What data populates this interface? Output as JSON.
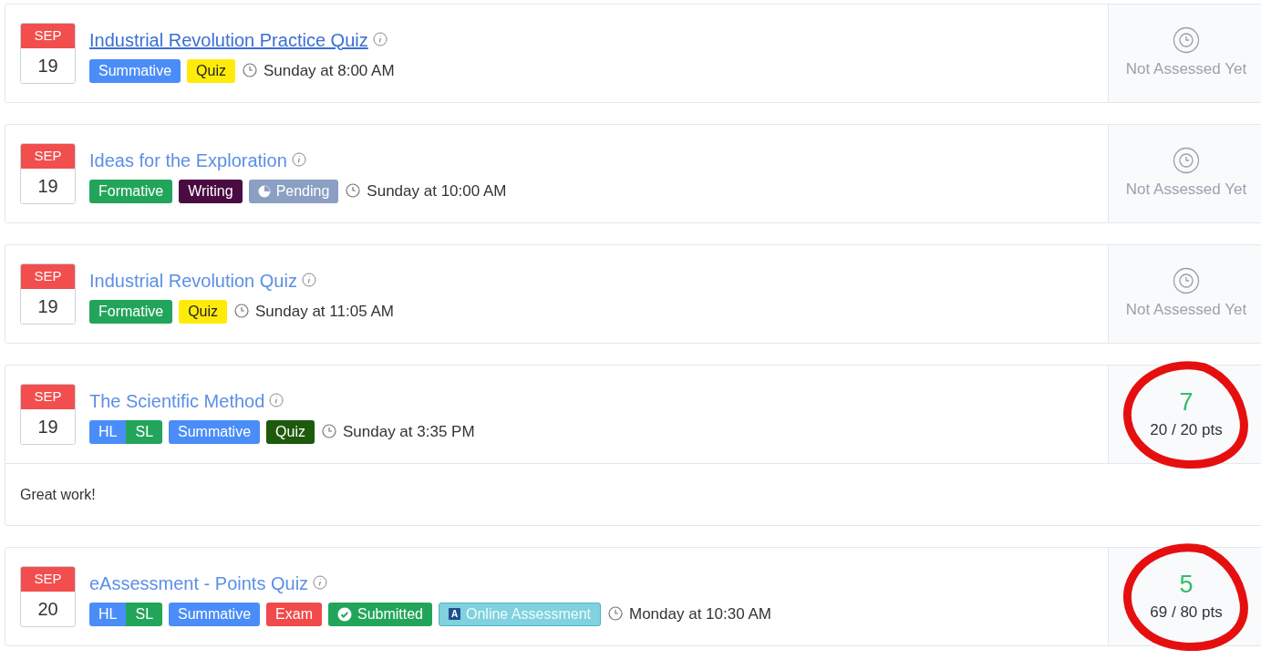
{
  "assignments": [
    {
      "month": "SEP",
      "day": "19",
      "title": "Industrial Revolution Practice Quiz",
      "underlined": true,
      "tags": [
        {
          "label": "Summative",
          "color": "#4b8df8",
          "kind": "plain"
        },
        {
          "label": "Quiz",
          "color": "#ffeb0a",
          "kind": "highlight"
        }
      ],
      "time": "Sunday at 8:00 AM",
      "grade": {
        "kind": "pending",
        "text": "Not Assessed Yet"
      },
      "circled": false
    },
    {
      "month": "SEP",
      "day": "19",
      "title": "Ideas for the Exploration",
      "underlined": false,
      "tags": [
        {
          "label": "Formative",
          "color": "#22a55a",
          "kind": "plain"
        },
        {
          "label": "Writing",
          "color": "#4a0a42",
          "kind": "plain"
        },
        {
          "label": "Pending",
          "color": "#8b9fc3",
          "kind": "pending"
        }
      ],
      "time": "Sunday at 10:00 AM",
      "grade": {
        "kind": "pending",
        "text": "Not Assessed Yet"
      },
      "circled": false
    },
    {
      "month": "SEP",
      "day": "19",
      "title": "Industrial Revolution Quiz",
      "underlined": false,
      "tags": [
        {
          "label": "Formative",
          "color": "#22a55a",
          "kind": "plain"
        },
        {
          "label": "Quiz",
          "color": "#ffeb0a",
          "kind": "highlight"
        }
      ],
      "time": "Sunday at 11:05 AM",
      "grade": {
        "kind": "pending",
        "text": "Not Assessed Yet"
      },
      "circled": false
    },
    {
      "month": "SEP",
      "day": "19",
      "title": "The Scientific Method",
      "underlined": false,
      "levels": [
        {
          "label": "HL",
          "color": "#4b8df8"
        },
        {
          "label": "SL",
          "color": "#22a55a"
        }
      ],
      "tags": [
        {
          "label": "Summative",
          "color": "#4b8df8",
          "kind": "plain"
        },
        {
          "label": "Quiz",
          "color": "#1d5a0c",
          "kind": "plain"
        }
      ],
      "time": "Sunday at 3:35 PM",
      "grade": {
        "kind": "graded",
        "score": "7",
        "points": "20 / 20 pts"
      },
      "feedback": "Great work!",
      "circled": true
    },
    {
      "month": "SEP",
      "day": "20",
      "title": "eAssessment - Points Quiz",
      "underlined": false,
      "levels": [
        {
          "label": "HL",
          "color": "#4b8df8"
        },
        {
          "label": "SL",
          "color": "#22a55a"
        }
      ],
      "tags": [
        {
          "label": "Summative",
          "color": "#4b8df8",
          "kind": "plain"
        },
        {
          "label": "Exam",
          "color": "#f04a4a",
          "kind": "plain"
        },
        {
          "label": "Submitted",
          "color": "#22a55a",
          "kind": "submitted"
        },
        {
          "label": "Online Assessment",
          "color": "#7fd2de",
          "kind": "online",
          "icon_letter": "A"
        }
      ],
      "time": "Monday at 10:30 AM",
      "grade": {
        "kind": "graded",
        "score": "5",
        "points": "69 / 80 pts"
      },
      "circled": true
    }
  ]
}
